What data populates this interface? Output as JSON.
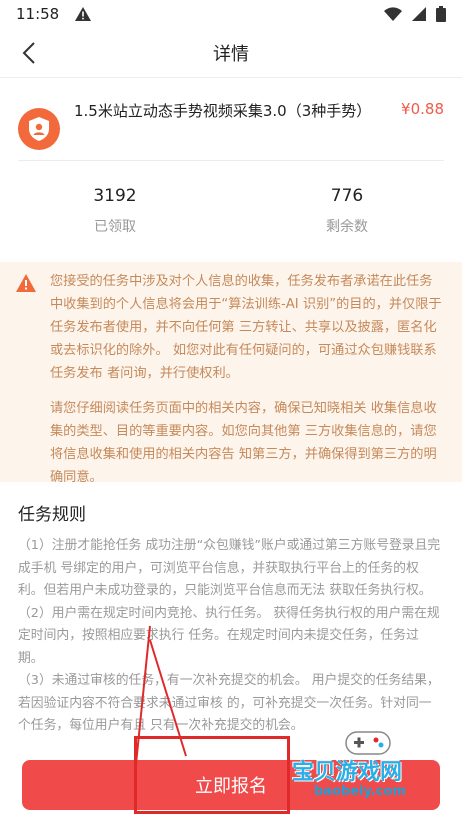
{
  "status_bar": {
    "time": "11:58"
  },
  "nav": {
    "title": "详情"
  },
  "task": {
    "title": "1.5米站立动态手势视频采集3.0（3种手势）",
    "price": "¥0.88",
    "accent": "#f26a3b"
  },
  "stats": [
    {
      "value": "3192",
      "label": "已领取"
    },
    {
      "value": "776",
      "label": "剩余数"
    }
  ],
  "notice": {
    "paragraph1": "您接受的任务中涉及对个人信息的收集，任务发布者承诺在此任务中收集到的个人信息将会用于“算法训练-AI 识别”的目的，并仅限于任务发布者使用，并不向任何第 三方转让、共享以及披露，匿名化或去标识化的除外。 如您对此有任何疑问的，可通过众包赚钱联系任务发布 者问询，并行使权利。",
    "paragraph2": "请您仔细阅读任务页面中的相关内容，确保已知晓相关 收集信息收集的类型、目的等重要内容。如您向其他第 三方收集信息的，请您将信息收集和使用的相关内容告 知第三方，并确保得到第三方的明确同意。"
  },
  "rules": {
    "title": "任务规则",
    "items": [
      "（1）注册才能抢任务 成功注册“众包赚钱”账户或通过第三方账号登录且完成手机 号绑定的用户，可浏览平台信息，并获取执行平台上的任务的权利。但若用户未成功登录的，只能浏览平台信息而无法 获取任务执行权。",
      "（2）用户需在规定时间内竞抢、执行任务。 获得任务执行权的用户需在规定时间内，按照相应要求执行 任务。在规定时间内未提交任务，任务过期。",
      "（3）未通过审核的任务，有一次补充提交的机会。 用户提交的任务结果，若因验证内容不符合要求未通过审核 的，可补充提交一次任务。针对同一个任务，每位用户有且 只有一次补充提交的机会。"
    ]
  },
  "signup_button": {
    "label": "立即报名",
    "color": "#f04a4a"
  },
  "watermark": {
    "text": "宝贝游戏网",
    "sub": "baobeiy.com"
  }
}
